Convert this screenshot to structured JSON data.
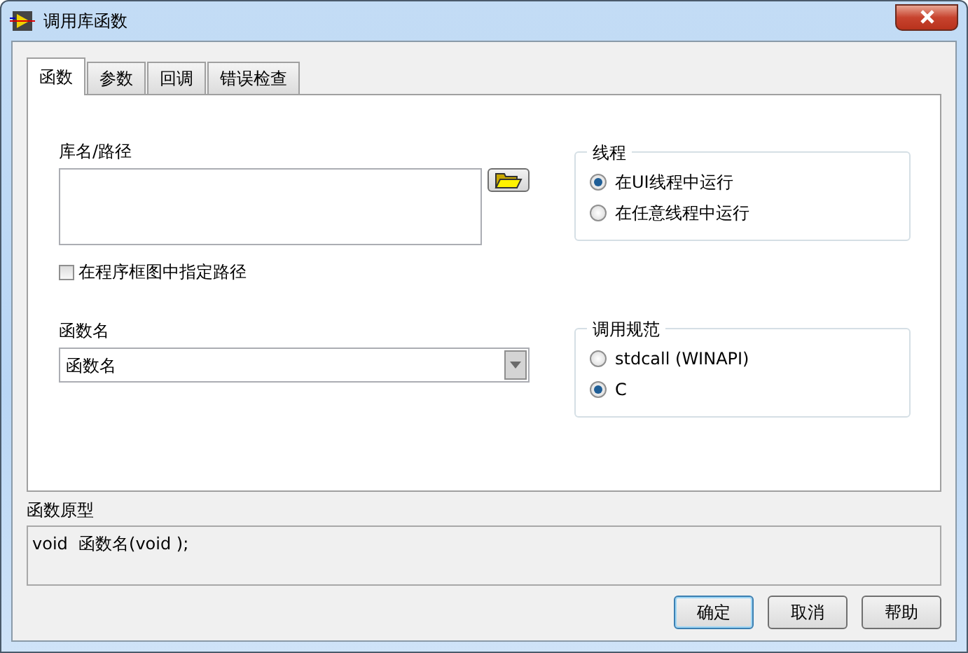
{
  "window": {
    "title": "调用库函数"
  },
  "tabs": [
    {
      "label": "函数",
      "selected": true
    },
    {
      "label": "参数",
      "selected": false
    },
    {
      "label": "回调",
      "selected": false
    },
    {
      "label": "错误检查",
      "selected": false
    }
  ],
  "library_path": {
    "label": "库名/路径"
  },
  "specify_path_on_diagram": {
    "label": "在程序框图中指定路径",
    "checked": false
  },
  "function_name": {
    "label": "函数名",
    "value": "函数名"
  },
  "thread": {
    "title": "线程",
    "options": [
      {
        "label": "在UI线程中运行",
        "selected": true
      },
      {
        "label": "在任意线程中运行",
        "selected": false
      }
    ]
  },
  "calling_convention": {
    "title": "调用规范",
    "options": [
      {
        "label": "stdcall (WINAPI)",
        "selected": false
      },
      {
        "label": "C",
        "selected": true
      }
    ]
  },
  "prototype": {
    "label": "函数原型",
    "value": "void  函数名(void );"
  },
  "buttons": [
    {
      "label": "确定",
      "default": true
    },
    {
      "label": "取消",
      "default": false
    },
    {
      "label": "帮助",
      "default": false
    }
  ]
}
